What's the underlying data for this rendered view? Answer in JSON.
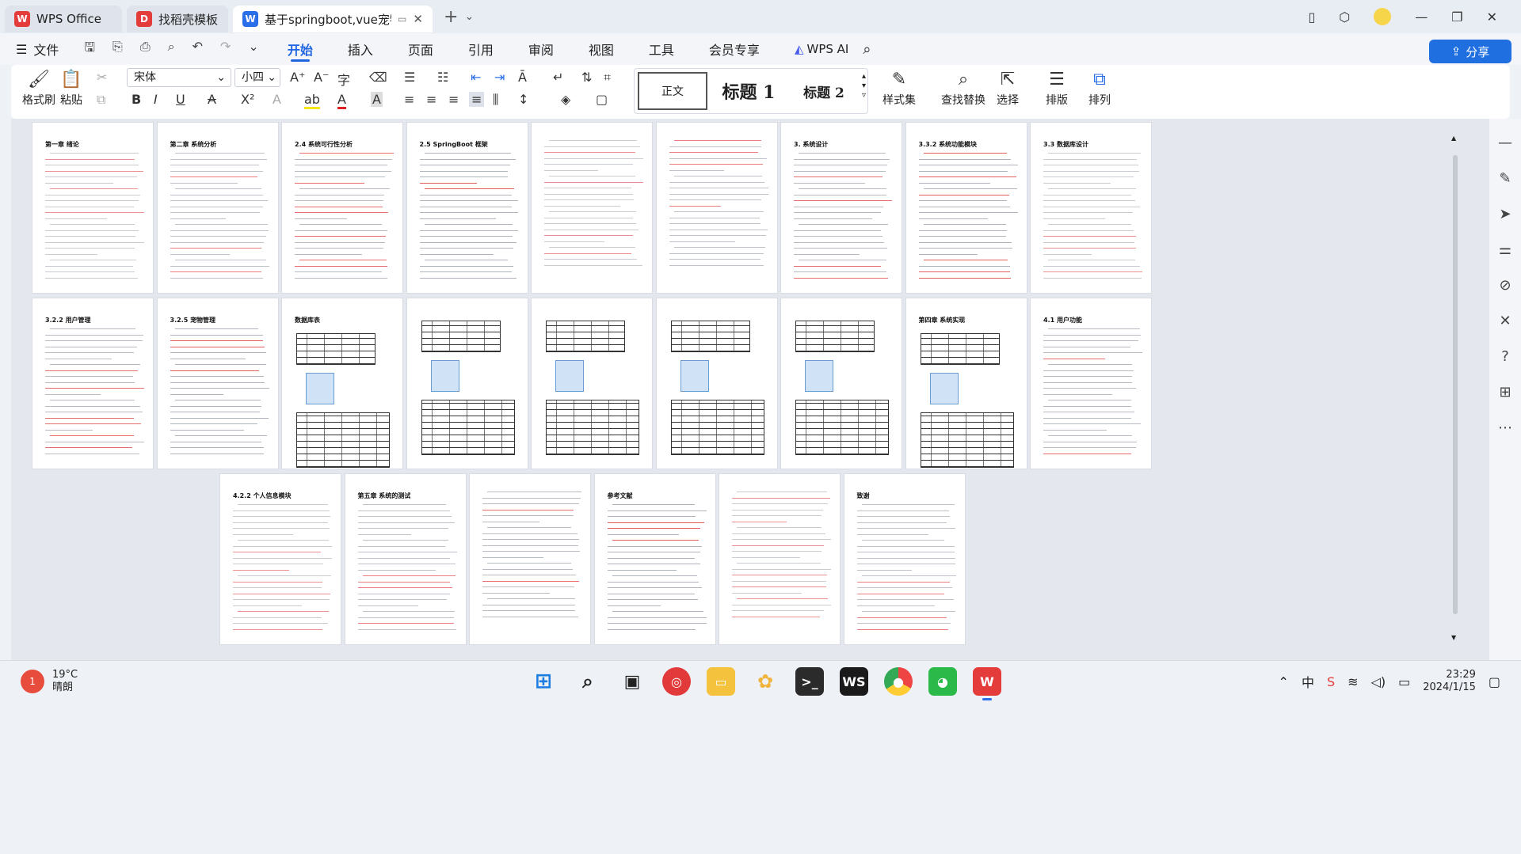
{
  "tabs": [
    {
      "label": "WPS Office",
      "icon": "wps-logo-icon",
      "color": "#e43b3b"
    },
    {
      "label": "找稻壳模板",
      "icon": "docer-icon",
      "color": "#e43b3b"
    },
    {
      "label": "基于springboot,vue宠物领养",
      "icon": "word-doc-icon",
      "color": "#2a6ee8"
    }
  ],
  "menu": {
    "file": "文件",
    "items": [
      "开始",
      "插入",
      "页面",
      "引用",
      "审阅",
      "视图",
      "工具",
      "会员专享"
    ],
    "active": "开始",
    "ai": "WPS AI",
    "share": "分享"
  },
  "ribbon": {
    "format_painter": "格式刷",
    "paste": "粘贴",
    "font_name": "宋体",
    "font_size": "小四",
    "styles": [
      "正文",
      "标题 1",
      "标题 2"
    ],
    "style_set": "样式集",
    "find_replace": "查找替换",
    "select": "选择",
    "layout": "排版",
    "arrange": "排列"
  },
  "pages_row1_headings": [
    "第一章 绪论",
    "第二章 系统分析",
    "2.4 系统可行性分析",
    "2.5 SpringBoot 框架",
    "",
    "",
    "3. 系统设计",
    "3.3.2 系统功能模块",
    "3.3 数据库设计"
  ],
  "pages_row2_headings": [
    "3.2.2 用户管理",
    "3.2.5 宠物管理",
    "数据库表",
    "",
    "",
    "",
    "",
    "第四章 系统实现",
    "4.1 用户功能"
  ],
  "pages_row3_headings": [
    "4.2.2 个人信息模块",
    "第五章 系统的测试",
    "",
    "参考文献",
    "",
    "致谢"
  ],
  "taskbar": {
    "temperature": "19°C",
    "weather": "晴朗",
    "weather_badge": "1",
    "time": "23:29",
    "date": "2024/1/15"
  }
}
